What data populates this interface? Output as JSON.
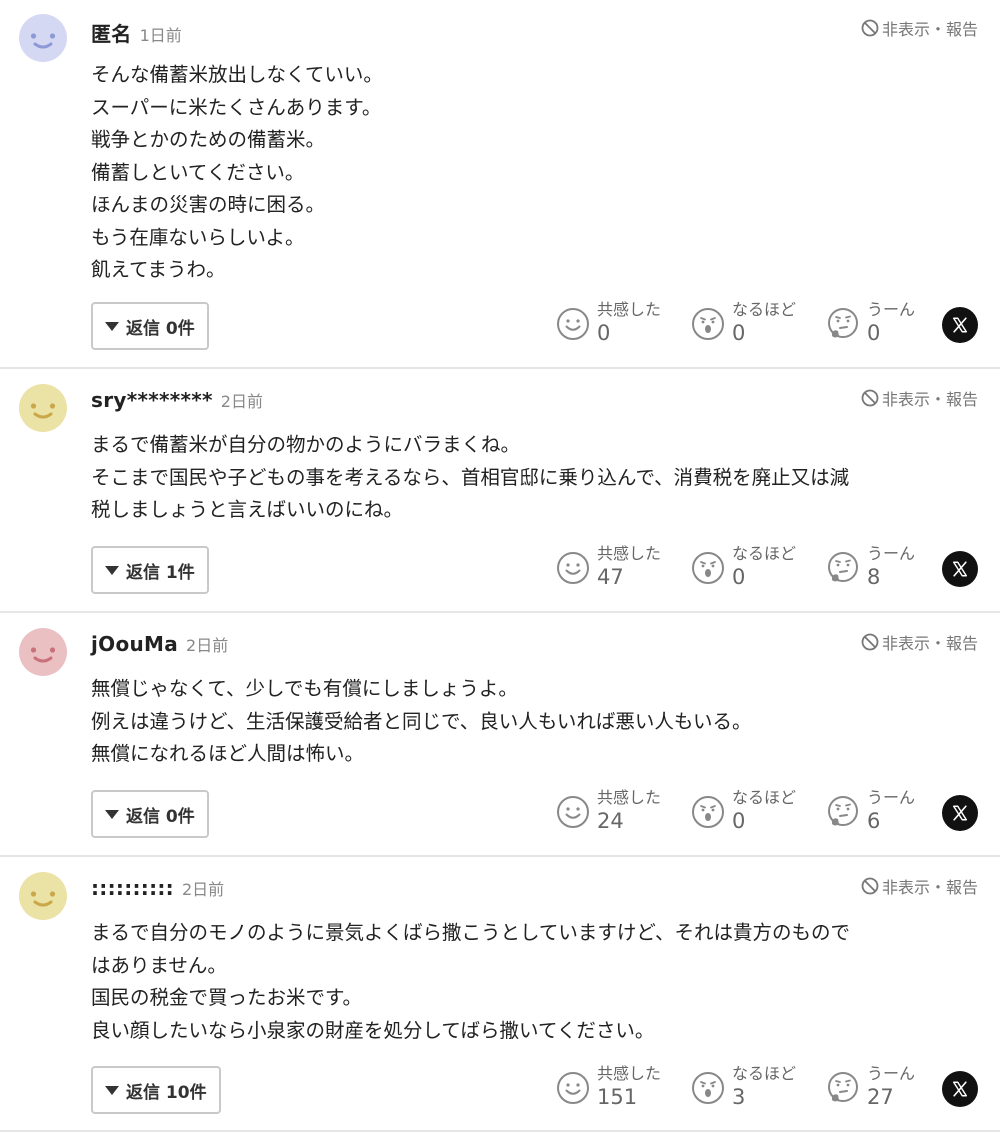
{
  "comments": [
    {
      "username": "匿名",
      "time": "1日前",
      "avatar_color": "#d5d8f2",
      "face_color": "#8e9ad6",
      "hide_report": "非表示・報告",
      "lines": [
        "そんな備蓄米放出しなくていい。",
        "スーパーに米たくさんあります。",
        "戦争とかのための備蓄米。",
        "備蓄しといてください。",
        "ほんまの災害の時に困る。",
        "もう在庫ないらしいよ。",
        "飢えてまうわ。"
      ],
      "reply_label": "返信 0件",
      "reactions": [
        {
          "label": "共感した",
          "count": "0",
          "icon": "smile-face-icon"
        },
        {
          "label": "なるほど",
          "count": "0",
          "icon": "surprised-face-icon"
        },
        {
          "label": "うーん",
          "count": "0",
          "icon": "thinking-face-icon"
        }
      ],
      "share_icon": "x-logo-icon"
    },
    {
      "username": "sry********",
      "time": "2日前",
      "avatar_color": "#ebe2a6",
      "face_color": "#c9a84a",
      "hide_report": "非表示・報告",
      "lines": [
        "まるで備蓄米が自分の物かのようにバラまくね。",
        "そこまで国民や子どもの事を考えるなら、首相官邸に乗り込んで、消費税を廃止又は減",
        "税しましょうと言えばいいのにね。"
      ],
      "reply_label": "返信 1件",
      "reactions": [
        {
          "label": "共感した",
          "count": "47",
          "icon": "smile-face-icon"
        },
        {
          "label": "なるほど",
          "count": "0",
          "icon": "surprised-face-icon"
        },
        {
          "label": "うーん",
          "count": "8",
          "icon": "thinking-face-icon"
        }
      ],
      "share_icon": "x-logo-icon"
    },
    {
      "username": "jOouMa",
      "time": "2日前",
      "avatar_color": "#ebc0c3",
      "face_color": "#c9707a",
      "hide_report": "非表示・報告",
      "lines": [
        "無償じゃなくて、少しでも有償にしましょうよ。",
        "例えは違うけど、生活保護受給者と同じで、良い人もいれば悪い人もいる。",
        "無償になれるほど人間は怖い。"
      ],
      "reply_label": "返信 0件",
      "reactions": [
        {
          "label": "共感した",
          "count": "24",
          "icon": "smile-face-icon"
        },
        {
          "label": "なるほど",
          "count": "0",
          "icon": "surprised-face-icon"
        },
        {
          "label": "うーん",
          "count": "6",
          "icon": "thinking-face-icon"
        }
      ],
      "share_icon": "x-logo-icon"
    },
    {
      "username": "::::::::::",
      "time": "2日前",
      "avatar_color": "#ebe2a6",
      "face_color": "#c9a84a",
      "hide_report": "非表示・報告",
      "lines": [
        "まるで自分のモノのように景気よくばら撒こうとしていますけど、それは貴方のもので",
        "はありません。",
        "国民の税金で買ったお米です。",
        "良い顔したいなら小泉家の財産を処分してばら撒いてください。"
      ],
      "reply_label": "返信 10件",
      "reactions": [
        {
          "label": "共感した",
          "count": "151",
          "icon": "smile-face-icon"
        },
        {
          "label": "なるほど",
          "count": "3",
          "icon": "surprised-face-icon"
        },
        {
          "label": "うーん",
          "count": "27",
          "icon": "thinking-face-icon"
        }
      ],
      "share_icon": "x-logo-icon"
    }
  ]
}
